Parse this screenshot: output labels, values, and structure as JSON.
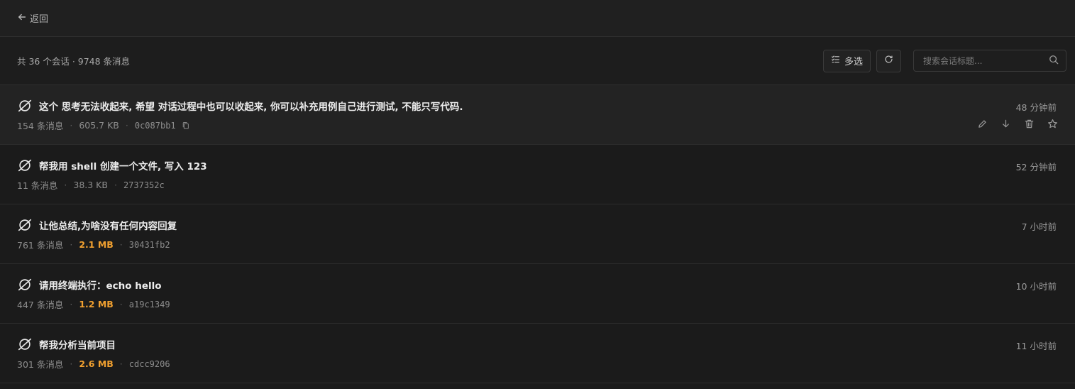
{
  "header": {
    "back_label": "返回"
  },
  "toolbar": {
    "summary": "共 36 个会话 · 9748 条消息",
    "multi_select_label": "多选",
    "search_placeholder": "搜索会话标题..."
  },
  "sessions": [
    {
      "title": "这个 思考无法收起来, 希望 对话过程中也可以收起来, 你可以补充用例自己进行测试, 不能只写代码.",
      "messages": "154 条消息",
      "size": "605.7 KB",
      "size_warning": false,
      "hash": "0c087bb1",
      "time": "48 分钟前"
    },
    {
      "title": "帮我用 shell 创建一个文件, 写入 123",
      "messages": "11 条消息",
      "size": "38.3 KB",
      "size_warning": false,
      "hash": "2737352c",
      "time": "52 分钟前"
    },
    {
      "title": "让他总结,为啥没有任何内容回复",
      "messages": "761 条消息",
      "size": "2.1 MB",
      "size_warning": true,
      "hash": "30431fb2",
      "time": "7 小时前"
    },
    {
      "title": "请用终端执行：echo hello",
      "messages": "447 条消息",
      "size": "1.2 MB",
      "size_warning": true,
      "hash": "a19c1349",
      "time": "10 小时前"
    },
    {
      "title": "帮我分析当前项目",
      "messages": "301 条消息",
      "size": "2.6 MB",
      "size_warning": true,
      "hash": "cdcc9206",
      "time": "11 小时前"
    }
  ],
  "colors": {
    "background": "#1b1b1b",
    "warning": "#f0a030",
    "text": "#ececec",
    "muted": "#8d8d8d"
  },
  "icons": [
    "arrow-left-icon",
    "checklist-icon",
    "refresh-icon",
    "search-icon",
    "app-logo-icon",
    "copy-icon",
    "edit-icon",
    "download-icon",
    "trash-icon",
    "star-icon"
  ]
}
